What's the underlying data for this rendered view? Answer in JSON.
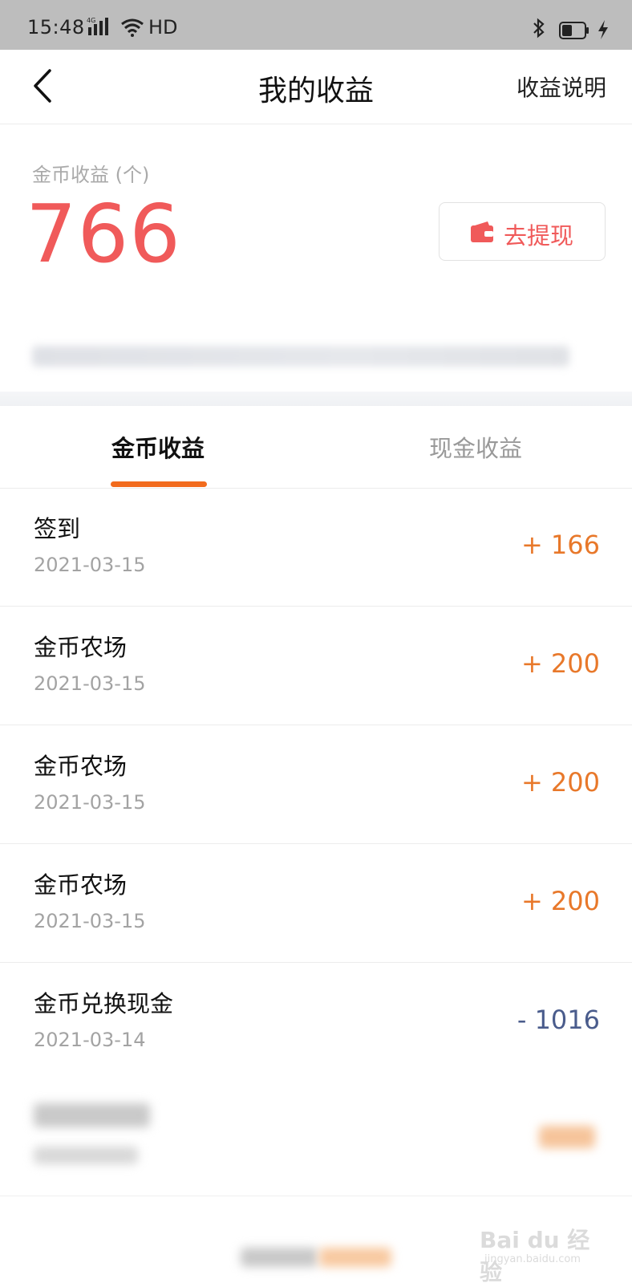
{
  "status_bar": {
    "time": "15:48",
    "network": "4G",
    "extra": "HD",
    "icons": [
      "signal-icon",
      "wifi-icon",
      "bluetooth-icon",
      "battery-icon",
      "charging-icon"
    ]
  },
  "nav": {
    "title": "我的收益",
    "right_label": "收益说明",
    "back_icon": "chevron-left-icon"
  },
  "balance": {
    "label": "金币收益 (个)",
    "value": "766",
    "withdraw_label": "去提现",
    "withdraw_icon": "wallet-icon"
  },
  "tabs": [
    {
      "label": "金币收益",
      "active": true
    },
    {
      "label": "现金收益",
      "active": false
    }
  ],
  "records": [
    {
      "title": "签到",
      "date": "2021-03-15",
      "amount": "+ 166"
    },
    {
      "title": "金币农场",
      "date": "2021-03-15",
      "amount": "+ 200"
    },
    {
      "title": "金币农场",
      "date": "2021-03-15",
      "amount": "+ 200"
    },
    {
      "title": "金币农场",
      "date": "2021-03-15",
      "amount": "+ 200"
    },
    {
      "title": "金币兑换现金",
      "date": "2021-03-14",
      "amount": "- 1016"
    }
  ],
  "colors": {
    "balance": "#f05a5a",
    "positive": "#e8782a",
    "negative": "#4a5c8c",
    "tab_indicator": "#f26b1d"
  },
  "watermark": {
    "brand": "Bai du 经验",
    "url": "jingyan.baidu.com"
  }
}
